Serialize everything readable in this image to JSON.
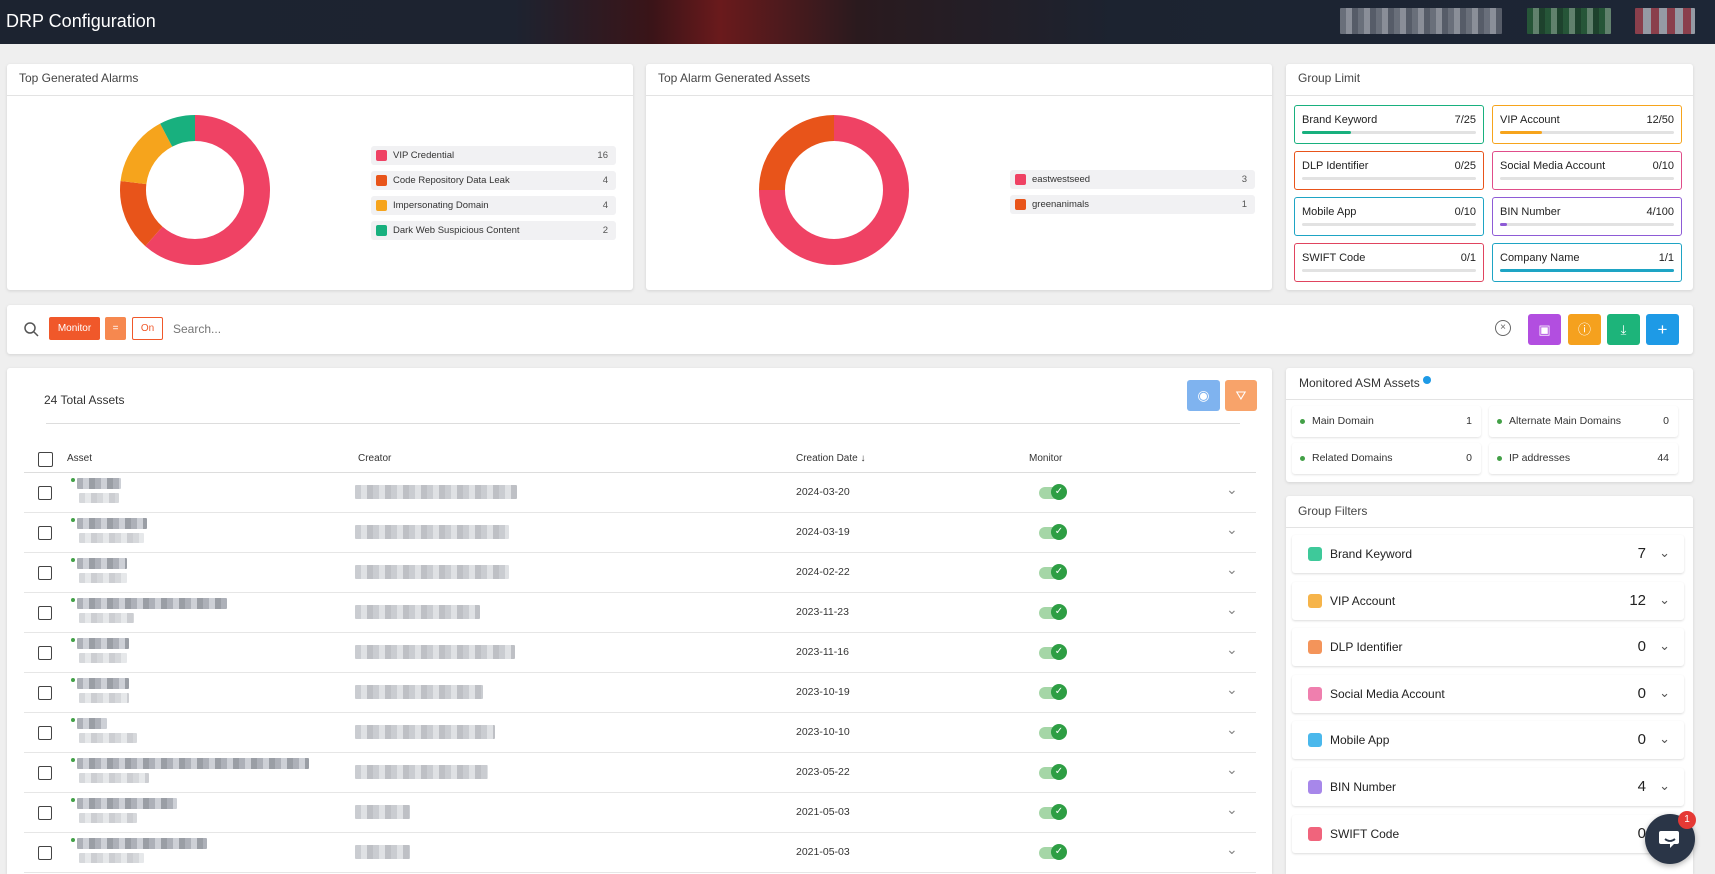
{
  "header": {
    "title": "DRP Configuration"
  },
  "alarms_card": {
    "title": "Top Generated Alarms",
    "items": [
      {
        "label": "VIP Credential",
        "count": "16",
        "color": "#ef4264"
      },
      {
        "label": "Code Repository Data Leak",
        "count": "4",
        "color": "#e8541a"
      },
      {
        "label": "Impersonating Domain",
        "count": "4",
        "color": "#f6a41c"
      },
      {
        "label": "Dark Web Suspicious Content",
        "count": "2",
        "color": "#18b07e"
      }
    ]
  },
  "assets_card": {
    "title": "Top Alarm Generated Assets",
    "items": [
      {
        "label": "eastwestseed",
        "count": "3",
        "color": "#ef4264"
      },
      {
        "label": "greenanimals",
        "count": "1",
        "color": "#e8541a"
      }
    ]
  },
  "group_limit": {
    "title": "Group Limit",
    "items": [
      {
        "name": "Brand Keyword",
        "value": "7/25",
        "fraction": 0.28,
        "color": "#18b07e"
      },
      {
        "name": "VIP Account",
        "value": "12/50",
        "fraction": 0.24,
        "color": "#f6a41c"
      },
      {
        "name": "DLP Identifier",
        "value": "0/25",
        "fraction": 0,
        "color": "#e8541a"
      },
      {
        "name": "Social Media Account",
        "value": "0/10",
        "fraction": 0,
        "color": "#e04d8a"
      },
      {
        "name": "Mobile App",
        "value": "0/10",
        "fraction": 0,
        "color": "#1ea4c4"
      },
      {
        "name": "BIN Number",
        "value": "4/100",
        "fraction": 0.04,
        "color": "#8e5bd6"
      },
      {
        "name": "SWIFT Code",
        "value": "0/1",
        "fraction": 0,
        "color": "#e0445f"
      },
      {
        "name": "Company Name",
        "value": "1/1",
        "fraction": 1.0,
        "color": "#1ea4c4"
      }
    ]
  },
  "search": {
    "chip_field": "Monitor",
    "chip_op": "=",
    "chip_value": "On",
    "placeholder": "Search..."
  },
  "assets_table": {
    "total_label": "24 Total Assets",
    "columns": {
      "asset": "Asset",
      "creator": "Creator",
      "date": "Creation Date",
      "monitor": "Monitor"
    },
    "rows": [
      {
        "date": "2024-03-20"
      },
      {
        "date": "2024-03-19"
      },
      {
        "date": "2024-02-22"
      },
      {
        "date": "2023-11-23"
      },
      {
        "date": "2023-11-16"
      },
      {
        "date": "2023-10-19"
      },
      {
        "date": "2023-10-10"
      },
      {
        "date": "2023-05-22"
      },
      {
        "date": "2021-05-03"
      },
      {
        "date": "2021-05-03"
      }
    ]
  },
  "asm": {
    "title": "Monitored ASM Assets",
    "items": [
      {
        "name": "Main Domain",
        "value": "1"
      },
      {
        "name": "Alternate Main Domains",
        "value": "0"
      },
      {
        "name": "Related Domains",
        "value": "0"
      },
      {
        "name": "IP addresses",
        "value": "44"
      }
    ]
  },
  "group_filters": {
    "title": "Group Filters",
    "items": [
      {
        "name": "Brand Keyword",
        "value": "7",
        "color": "#3ec99a"
      },
      {
        "name": "VIP Account",
        "value": "12",
        "color": "#f6b44a"
      },
      {
        "name": "DLP Identifier",
        "value": "0",
        "color": "#f4945a"
      },
      {
        "name": "Social Media Account",
        "value": "0",
        "color": "#ef7fae"
      },
      {
        "name": "Mobile App",
        "value": "0",
        "color": "#4ab8ec"
      },
      {
        "name": "BIN Number",
        "value": "4",
        "color": "#a787ea"
      },
      {
        "name": "SWIFT Code",
        "value": "0",
        "color": "#f0647c"
      }
    ]
  },
  "chat": {
    "badge": "1"
  }
}
